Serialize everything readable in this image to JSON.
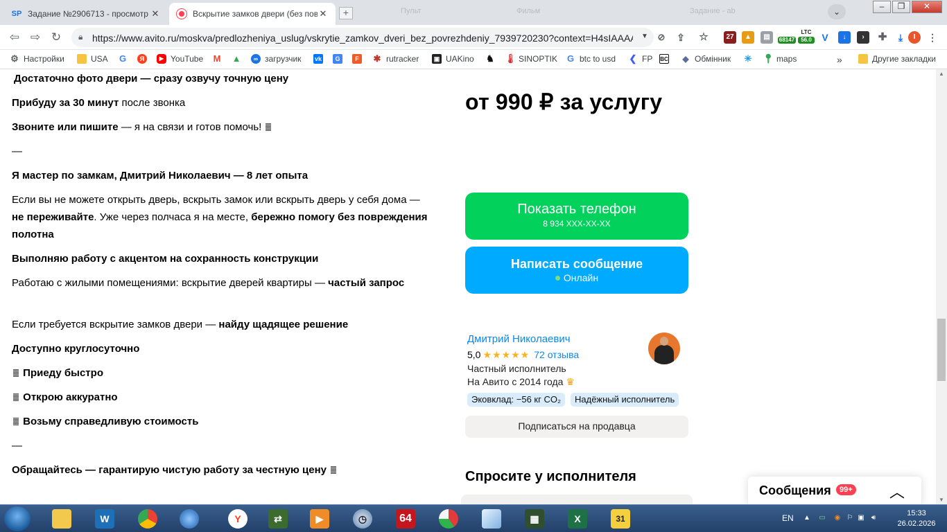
{
  "browser": {
    "tabs": [
      {
        "favicon": "SP",
        "title": "Задание №2906713 - просмотр з"
      },
      {
        "favicon": "avito",
        "title": "Вскрытие замков двери (без повр"
      }
    ],
    "faded_tabs": [
      "Пульт",
      "Фильм",
      "Задание - ab"
    ],
    "url": "https://www.avito.ru/moskva/predlozheniya_uslug/vskrytie_zamkov_dveri_bez_povrezhdeniy_7939720230?context=H4sIAAAA...",
    "extension_badges": {
      "ext1": "27",
      "ltc_label": "LTC",
      "ltc_value": "56.0",
      "btc_value": "68147"
    },
    "bookmarks": [
      {
        "label": "Настройки",
        "icon": "gear-icon"
      },
      {
        "label": "USA",
        "icon": "folder-icon"
      },
      {
        "label": "",
        "icon": "google-icon"
      },
      {
        "label": "",
        "icon": "yandex-icon"
      },
      {
        "label": "YouTube",
        "icon": "youtube-icon"
      },
      {
        "label": "",
        "icon": "gmail-icon"
      },
      {
        "label": "",
        "icon": "drive-icon"
      },
      {
        "label": "загрузчик",
        "icon": "loader-icon"
      },
      {
        "label": "",
        "icon": "vk-icon"
      },
      {
        "label": "",
        "icon": "translate-icon"
      },
      {
        "label": "",
        "icon": "f-icon"
      },
      {
        "label": "rutracker",
        "icon": "rutracker-icon"
      },
      {
        "label": "UAKino",
        "icon": "uakino-icon"
      },
      {
        "label": "",
        "icon": "horse-icon"
      },
      {
        "label": "SINOPTIK",
        "icon": "thermometer-icon"
      },
      {
        "label": "btc to usd",
        "icon": "google-icon"
      },
      {
        "label": "FP",
        "icon": "fp-icon"
      },
      {
        "label": "",
        "icon": "bc-icon"
      },
      {
        "label": "Обмінник",
        "icon": "exchange-icon"
      },
      {
        "label": "",
        "icon": "star-icon"
      },
      {
        "label": "maps",
        "icon": "maps-icon"
      }
    ],
    "more_bookmarks": "»",
    "other_bookmarks": "Другие закладки"
  },
  "listing": {
    "description": {
      "p1_b": "Достаточно фото двери — сразу озвучу точную цену",
      "p2_b": "Прибуду за 30 минут",
      "p2_t": " после звонка",
      "p3_b": "Звоните или пишите",
      "p3_t": " — я на связи и готов помочь! ",
      "sep1": "—",
      "p4_b": "Я мастер по замкам, Дмитрий Николаевич — 8 лет опыта",
      "p5_t1": "Если вы не можете открыть дверь, вскрыть замок или вскрыть дверь у себя дома — ",
      "p5_b1": "не переживайте",
      "p5_t2": ". Уже через полчаса я на месте, ",
      "p5_b2": "бережно помогу без повреждения полотна",
      "p6_b": "Выполняю работу с акцентом на сохранность конструкции",
      "p7_t": "Работаю с жилыми помещениями: вскрытие дверей квартиры — ",
      "p7_b": "частый запрос",
      "p8_t": "Если требуется вскрытие замков двери — ",
      "p8_b": "найду щадящее решение",
      "p9_b": "Доступно круглосуточно",
      "p10_b": "Приеду быстро",
      "p11_b": "Открою аккуратно",
      "p12_b": "Возьму справедливую стоимость",
      "sep2": "—",
      "p13_b": "Обращайтесь — гарантирую чистую работу за честную цену"
    },
    "price": "от 990 ₽ за услугу",
    "phone_button": {
      "label": "Показать телефон",
      "number": "8 934 XXX-XX-XX"
    },
    "message_button": {
      "label": "Написать сообщение",
      "status": "Онлайн"
    },
    "seller": {
      "name": "Дмитрий Николаевич",
      "rating": "5,0",
      "stars": "★★★★★",
      "reviews": "72 отзыва",
      "type": "Частный исполнитель",
      "since": "На Авито с 2014 года",
      "badge_eco": "Эковклад: −56 кг CO₂",
      "badge_reliable": "Надёжный исполнитель",
      "subscribe": "Подписаться на продавца"
    },
    "ask_title": "Спросите у исполнителя",
    "messages_widget": {
      "title": "Сообщения",
      "count": "99+"
    }
  },
  "taskbar": {
    "lang": "EN",
    "time": "15:33",
    "date": "26.02.2026",
    "apps": [
      "explorer",
      "webroot",
      "chrome",
      "network",
      "yandex",
      "winamp",
      "media",
      "clock",
      "64",
      "pie",
      "docs",
      "monitor",
      "excel",
      "calendar"
    ],
    "calendar_day": "31",
    "badge_64": "64"
  },
  "colors": {
    "green_button": "#02d15c",
    "blue_button": "#00aaff",
    "link": "#0a88ee",
    "badge_bg": "#d8ecfb",
    "messages_badge": "#ff4053"
  }
}
